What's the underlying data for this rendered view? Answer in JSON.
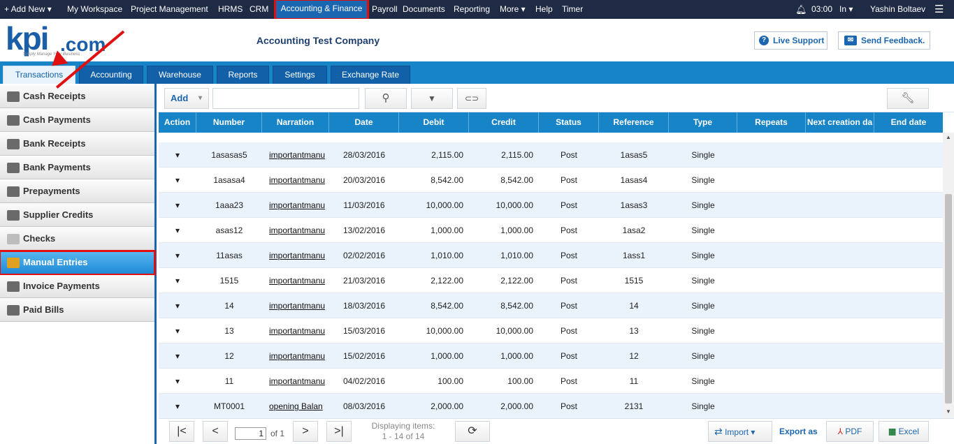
{
  "topnav": {
    "add_new": "+ Add New ▾",
    "items": [
      "My Workspace",
      "Project Management",
      "HRMS",
      "CRM",
      "Payroll",
      "Documents",
      "Reporting",
      "More ▾",
      "Help",
      "Timer"
    ],
    "active": "Accounting & Finance",
    "time": "03:00",
    "in_label": "In ▾",
    "user": "Yashin Boltaev"
  },
  "header": {
    "logo_text": "kpi",
    "logo_suffix": ".com",
    "tagline": "Simply Manage Your Business",
    "company": "Accounting Test Company",
    "live_support": "Live Support",
    "send_feedback": "Send Feedback."
  },
  "tabs": [
    "Transactions",
    "Accounting",
    "Warehouse",
    "Reports",
    "Settings",
    "Exchange Rate"
  ],
  "sidebar": {
    "items": [
      "Cash Receipts",
      "Cash Payments",
      "Bank Receipts",
      "Bank Payments",
      "Prepayments",
      "Supplier Credits",
      "Checks",
      "Manual Entries",
      "Invoice Payments",
      "Paid Bills"
    ],
    "active": "Manual Entries"
  },
  "toolbar": {
    "add_label": "Add",
    "search_value": ""
  },
  "grid": {
    "columns": [
      "Action",
      "Number",
      "Narration",
      "Date",
      "Debit",
      "Credit",
      "Status",
      "Reference",
      "Type",
      "Repeats",
      "Next creation da",
      "End date"
    ],
    "rows": [
      [
        "▾",
        "1asasas5",
        "importantmanu",
        "28/03/2016",
        "2,115.00",
        "2,115.00",
        "Post",
        "1asas5",
        "Single"
      ],
      [
        "▾",
        "1asasa4",
        "importantmanu",
        "20/03/2016",
        "8,542.00",
        "8,542.00",
        "Post",
        "1asas4",
        "Single"
      ],
      [
        "▾",
        "1aaa23",
        "importantmanu",
        "11/03/2016",
        "10,000.00",
        "10,000.00",
        "Post",
        "1asas3",
        "Single"
      ],
      [
        "▾",
        "asas12",
        "importantmanu",
        "13/02/2016",
        "1,000.00",
        "1,000.00",
        "Post",
        "1asa2",
        "Single"
      ],
      [
        "▾",
        "11asas",
        "importantmanu",
        "02/02/2016",
        "1,010.00",
        "1,010.00",
        "Post",
        "1ass1",
        "Single"
      ],
      [
        "▾",
        "1515",
        "importantmanu",
        "21/03/2016",
        "2,122.00",
        "2,122.00",
        "Post",
        "1515",
        "Single"
      ],
      [
        "▾",
        "14",
        "importantmanu",
        "18/03/2016",
        "8,542.00",
        "8,542.00",
        "Post",
        "14",
        "Single"
      ],
      [
        "▾",
        "13",
        "importantmanu",
        "15/03/2016",
        "10,000.00",
        "10,000.00",
        "Post",
        "13",
        "Single"
      ],
      [
        "▾",
        "12",
        "importantmanu",
        "15/02/2016",
        "1,000.00",
        "1,000.00",
        "Post",
        "12",
        "Single"
      ],
      [
        "▾",
        "11",
        "importantmanu",
        "04/02/2016",
        "100.00",
        "100.00",
        "Post",
        "11",
        "Single"
      ],
      [
        "▾",
        "MT0001",
        "opening Balan",
        "08/03/2016",
        "2,000.00",
        "2,000.00",
        "Post",
        "2131",
        "Single"
      ]
    ]
  },
  "pager": {
    "page": "1",
    "of_label": "of 1",
    "displaying_line1": "Displaying items:",
    "displaying_line2": "1 - 14 of 14",
    "import_label": "Import ▾",
    "export_label": "Export as",
    "pdf_label": "PDF",
    "excel_label": "Excel"
  }
}
